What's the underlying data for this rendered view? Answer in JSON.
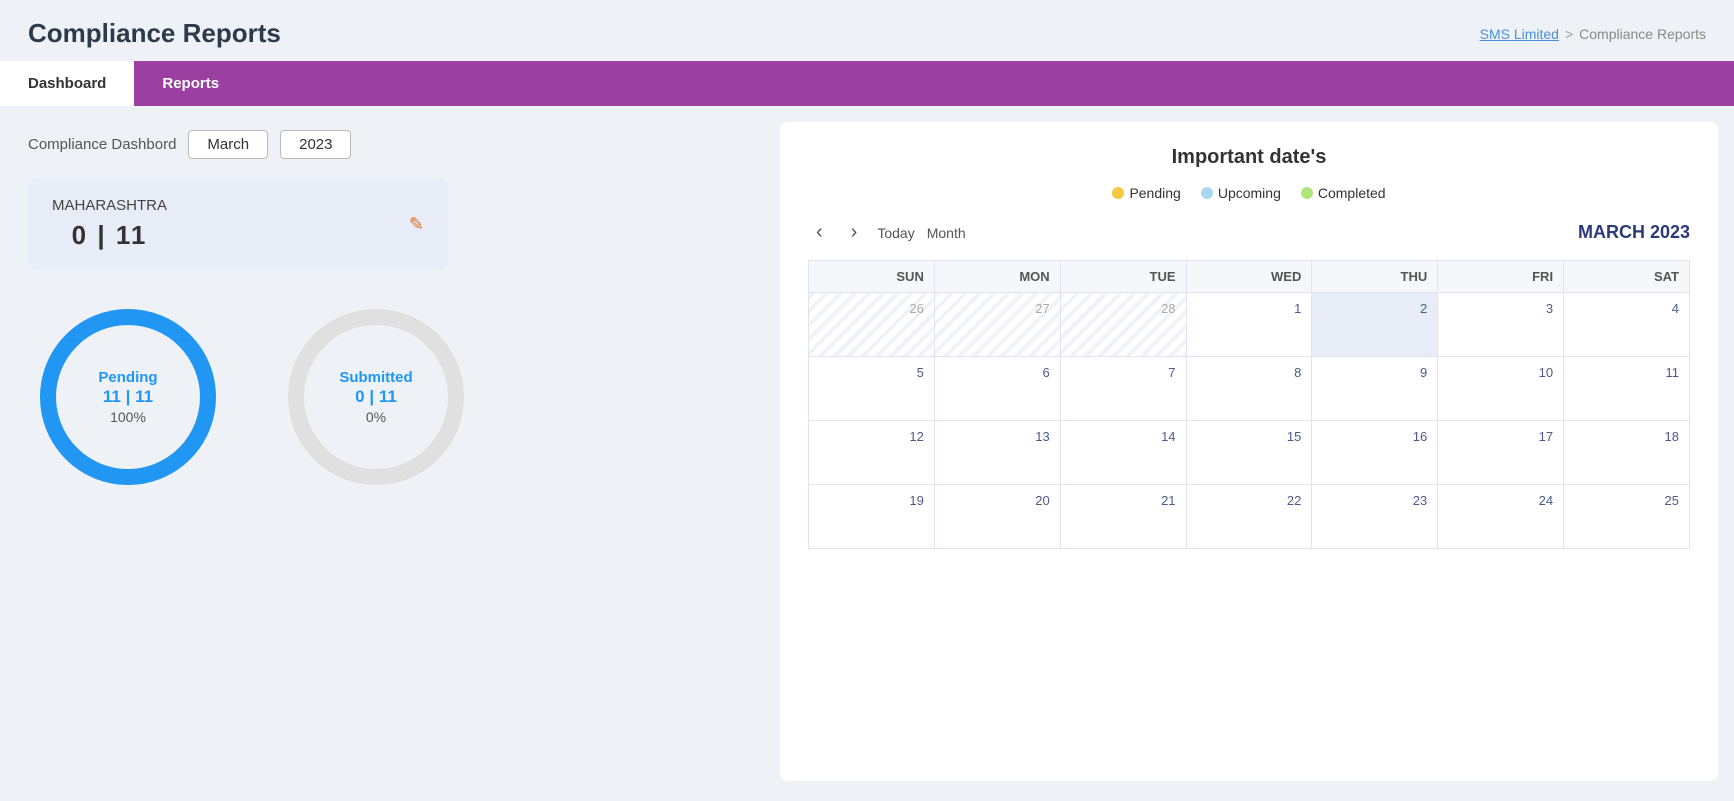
{
  "header": {
    "title": "Compliance Reports",
    "breadcrumb": {
      "parent": "SMS Limited",
      "separator": ">",
      "current": "Compliance Reports"
    }
  },
  "tabs": [
    {
      "id": "dashboard",
      "label": "Dashboard",
      "active": true
    },
    {
      "id": "reports",
      "label": "Reports",
      "active": false
    }
  ],
  "dashboard": {
    "label": "Compliance Dashbord",
    "month": "March",
    "year": "2023",
    "state": {
      "name": "MAHARASHTRA",
      "submitted": "0",
      "total": "11"
    },
    "pending": {
      "label": "Pending",
      "numerator": "11",
      "denominator": "11",
      "percent": "100%"
    },
    "submitted": {
      "label": "Submitted",
      "numerator": "0",
      "denominator": "11",
      "percent": "0%"
    }
  },
  "calendar": {
    "title": "Important date's",
    "legend": [
      {
        "label": "Pending",
        "color": "#f5c842"
      },
      {
        "label": "Upcoming",
        "color": "#a8d8f0"
      },
      {
        "label": "Completed",
        "color": "#b0e57c"
      }
    ],
    "nav": {
      "today": "Today",
      "month_view": "Month",
      "month_year": "MARCH 2023"
    },
    "days": [
      "SUN",
      "MON",
      "TUE",
      "WED",
      "THU",
      "FRI",
      "SAT"
    ],
    "weeks": [
      [
        {
          "num": "26",
          "prev": true
        },
        {
          "num": "27",
          "prev": true
        },
        {
          "num": "28",
          "prev": true
        },
        {
          "num": "1",
          "prev": false
        },
        {
          "num": "2",
          "prev": false,
          "today": true
        },
        {
          "num": "3",
          "prev": false
        },
        {
          "num": "4",
          "prev": false
        }
      ],
      [
        {
          "num": "5",
          "prev": false
        },
        {
          "num": "6",
          "prev": false
        },
        {
          "num": "7",
          "prev": false
        },
        {
          "num": "8",
          "prev": false
        },
        {
          "num": "9",
          "prev": false
        },
        {
          "num": "10",
          "prev": false
        },
        {
          "num": "11",
          "prev": false
        }
      ],
      [
        {
          "num": "12",
          "prev": false
        },
        {
          "num": "13",
          "prev": false
        },
        {
          "num": "14",
          "prev": false
        },
        {
          "num": "15",
          "prev": false
        },
        {
          "num": "16",
          "prev": false
        },
        {
          "num": "17",
          "prev": false
        },
        {
          "num": "18",
          "prev": false
        }
      ],
      [
        {
          "num": "19",
          "prev": false
        },
        {
          "num": "20",
          "prev": false
        },
        {
          "num": "21",
          "prev": false
        },
        {
          "num": "22",
          "prev": false
        },
        {
          "num": "23",
          "prev": false
        },
        {
          "num": "24",
          "prev": false
        },
        {
          "num": "25",
          "prev": false
        }
      ]
    ]
  }
}
